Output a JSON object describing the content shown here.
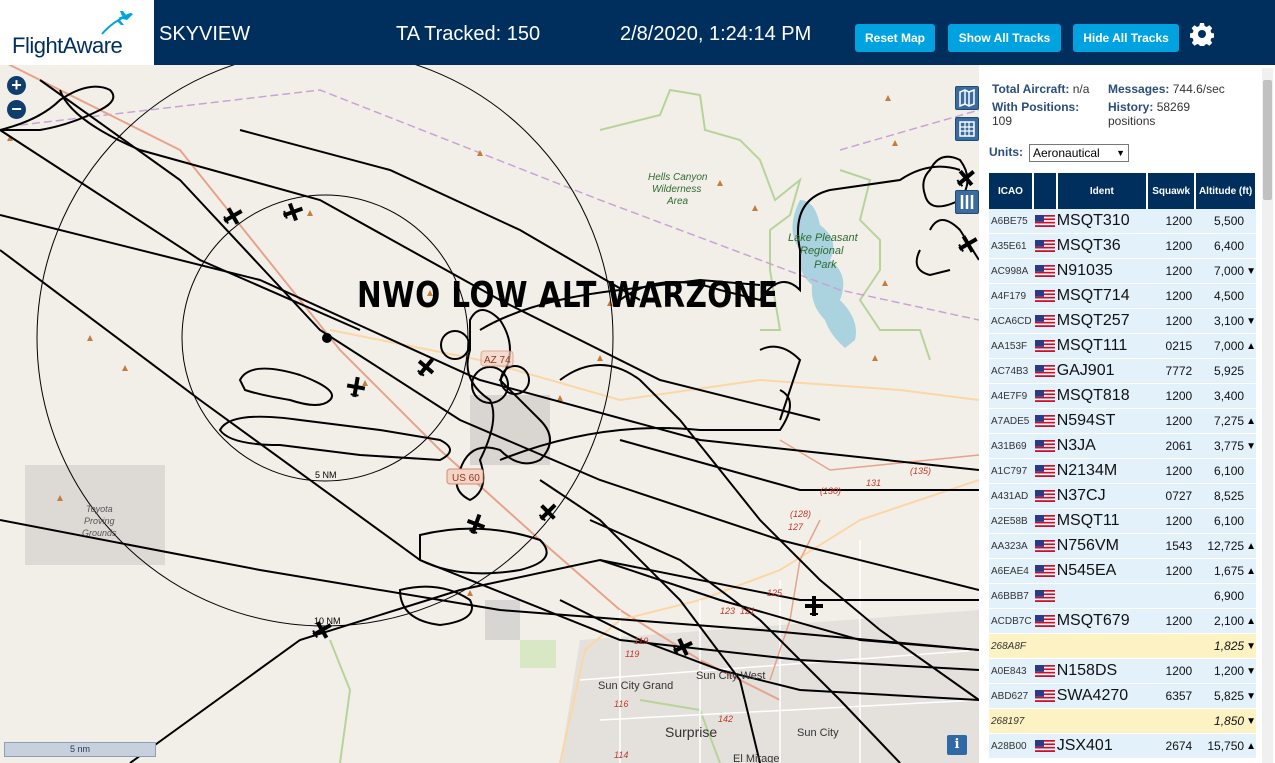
{
  "header": {
    "logo_text": "FlightAware",
    "app_name": "SKYVIEW",
    "tracked": "TA Tracked: 150",
    "datetime": "2/8/2020, 1:24:14 PM",
    "reset_map": "Reset Map",
    "show_all": "Show All Tracks",
    "hide_all": "Hide All Tracks",
    "gear_icon": "gear-icon"
  },
  "map": {
    "overlay_title": "NWO LOW ALT WARZONE",
    "labels": {
      "hells_canyon": "Hells Canyon",
      "wilderness": "Wilderness",
      "area": "Area",
      "lake": "Lake Pleasant",
      "regional": "Regional",
      "park": "Park",
      "toyota": "Toyota",
      "proving": "Proving",
      "grounds": "Grounds",
      "us60": "US 60",
      "az74": "AZ 74",
      "sun_city_grand": "Sun City Grand",
      "sun_city_west": "Sun City West",
      "surprise": "Surprise",
      "sun_city": "Sun City",
      "el_mirage": "El Mirage",
      "ring5": "5 NM",
      "ring10": "10 NM",
      "r135": "(135)",
      "r131": "131",
      "r130": "(130)",
      "r128": "(128)",
      "r127": "127",
      "r125": "125",
      "r123": "123",
      "r121": "121",
      "r119a": "119",
      "r119b": "119",
      "r116": "116",
      "r114": "114",
      "r142": "142"
    },
    "scale": "5 nm",
    "info": "i"
  },
  "panel": {
    "total_label": "Total Aircraft:",
    "total_value": "n/a",
    "messages_label": "Messages:",
    "messages_value": "744.6/sec",
    "positions_label": "With Positions:",
    "positions_value": "109",
    "history_label": "History:",
    "history_value": "58269",
    "history_unit": "positions",
    "units_label": "Units:",
    "units_value": "Aeronautical",
    "columns": [
      "ICAO",
      "Ident",
      "Squawk",
      "Altitude (ft)"
    ],
    "rows": [
      {
        "icao": "A6BE75",
        "flag": true,
        "ident": "MSQT310",
        "squawk": "1200",
        "alt": "5,500",
        "arrow": ""
      },
      {
        "icao": "A35E61",
        "flag": true,
        "ident": "MSQT36",
        "squawk": "1200",
        "alt": "6,400",
        "arrow": ""
      },
      {
        "icao": "AC998A",
        "flag": true,
        "ident": "N91035",
        "squawk": "1200",
        "alt": "7,000",
        "arrow": "▼"
      },
      {
        "icao": "A4F179",
        "flag": true,
        "ident": "MSQT714",
        "squawk": "1200",
        "alt": "4,500",
        "arrow": ""
      },
      {
        "icao": "ACA6CD",
        "flag": true,
        "ident": "MSQT257",
        "squawk": "1200",
        "alt": "3,100",
        "arrow": "▼"
      },
      {
        "icao": "AA153F",
        "flag": true,
        "ident": "MSQT111",
        "squawk": "0215",
        "alt": "7,000",
        "arrow": "▲"
      },
      {
        "icao": "AC74B3",
        "flag": true,
        "ident": "GAJ901",
        "squawk": "7772",
        "alt": "5,925",
        "arrow": ""
      },
      {
        "icao": "A4E7F9",
        "flag": true,
        "ident": "MSQT818",
        "squawk": "1200",
        "alt": "3,400",
        "arrow": ""
      },
      {
        "icao": "A7ADE5",
        "flag": true,
        "ident": "N594ST",
        "squawk": "1200",
        "alt": "7,275",
        "arrow": "▲"
      },
      {
        "icao": "A31B69",
        "flag": true,
        "ident": "N3JA",
        "squawk": "2061",
        "alt": "3,775",
        "arrow": "▼"
      },
      {
        "icao": "A1C797",
        "flag": true,
        "ident": "N2134M",
        "squawk": "1200",
        "alt": "6,100",
        "arrow": ""
      },
      {
        "icao": "A431AD",
        "flag": true,
        "ident": "N37CJ",
        "squawk": "0727",
        "alt": "8,525",
        "arrow": ""
      },
      {
        "icao": "A2E58B",
        "flag": true,
        "ident": "MSQT11",
        "squawk": "1200",
        "alt": "6,100",
        "arrow": ""
      },
      {
        "icao": "AA323A",
        "flag": true,
        "ident": "N756VM",
        "squawk": "1543",
        "alt": "12,725",
        "arrow": "▲"
      },
      {
        "icao": "A6EAE4",
        "flag": true,
        "ident": "N545EA",
        "squawk": "1200",
        "alt": "1,675",
        "arrow": "▲"
      },
      {
        "icao": "A6BBB7",
        "flag": true,
        "ident": "",
        "squawk": "",
        "alt": "6,900",
        "arrow": ""
      },
      {
        "icao": "ACDB7C",
        "flag": true,
        "ident": "MSQT679",
        "squawk": "1200",
        "alt": "2,100",
        "arrow": "▲"
      },
      {
        "icao": "268A8F",
        "flag": false,
        "ident": "",
        "squawk": "",
        "alt": "1,825",
        "arrow": "▼",
        "hl": true
      },
      {
        "icao": "A0E843",
        "flag": true,
        "ident": "N158DS",
        "squawk": "1200",
        "alt": "1,200",
        "arrow": "▼"
      },
      {
        "icao": "ABD627",
        "flag": true,
        "ident": "SWA4270",
        "squawk": "6357",
        "alt": "5,825",
        "arrow": "▼"
      },
      {
        "icao": "268197",
        "flag": false,
        "ident": "",
        "squawk": "",
        "alt": "1,850",
        "arrow": "▼",
        "hl": true
      },
      {
        "icao": "A28B00",
        "flag": true,
        "ident": "JSX401",
        "squawk": "2674",
        "alt": "15,750",
        "arrow": "▲"
      }
    ]
  }
}
